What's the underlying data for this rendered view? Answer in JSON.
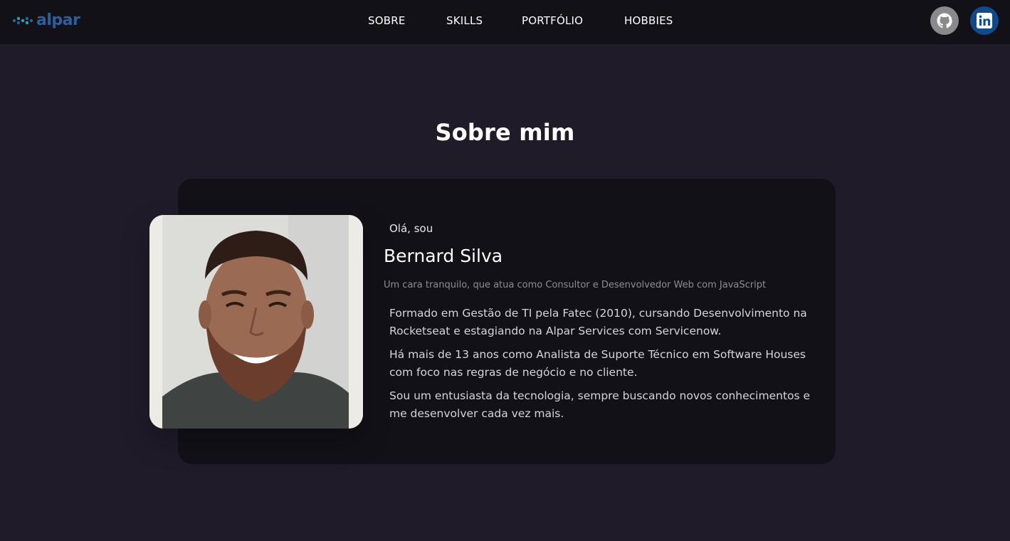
{
  "header": {
    "logo_text": "alpar",
    "nav": [
      {
        "label": "SOBRE"
      },
      {
        "label": "SKILLS"
      },
      {
        "label": "PORTFÓLIO"
      },
      {
        "label": "HOBBIES"
      }
    ],
    "social": [
      {
        "icon": "github-icon",
        "color": "#8a8a8c"
      },
      {
        "icon": "linkedin-icon",
        "color": "#104a8a"
      }
    ]
  },
  "about": {
    "title": "Sobre mim",
    "greeting": "Olá, sou",
    "name": "Bernard Silva",
    "tagline": "Um cara tranquilo, que atua como Consultor e Desenvolvedor Web com JavaScript",
    "paragraphs": [
      "Formado em Gestão de TI pela Fatec (2010), cursando Desenvolvimento na Rocketseat e estagiando na Alpar Services com Servicenow.",
      "Há mais de 13 anos como Analista de Suporte Técnico em Software Houses com foco nas regras de negócio e no cliente.",
      "Sou um entusiasta da tecnologia, sempre buscando novos conhecimentos e me desenvolver cada vez mais."
    ]
  },
  "colors": {
    "page_bg": "#1f1b29",
    "header_bg": "#121117",
    "card_bg": "#121118",
    "brand": "#2d5f9e"
  }
}
